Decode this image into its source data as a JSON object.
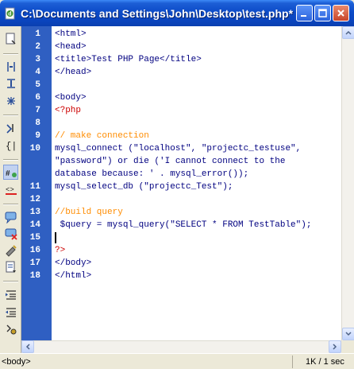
{
  "window": {
    "title": "C:\\Documents and Settings\\John\\Desktop\\test.php*",
    "app_icon": "dreamweaver-file-icon"
  },
  "toolbar": {
    "icons": [
      "document-icon",
      "expand-tag-icon",
      "collapse-selection-icon",
      "collapse-full-icon",
      "select-parent-tag-icon",
      "balance-braces-icon",
      "line-numbers-icon",
      "highlight-invalid-icon",
      "apply-comment-icon",
      "remove-comment-icon",
      "wrap-tag-icon",
      "recent-snippets-icon",
      "indent-icon",
      "outdent-icon",
      "format-source-icon"
    ]
  },
  "editor": {
    "lines": [
      {
        "n": "1",
        "text": "<html>",
        "kind": "tag"
      },
      {
        "n": "2",
        "text": "<head>",
        "kind": "tag"
      },
      {
        "n": "3",
        "text": "<title>Test PHP Page</title>",
        "kind": "tag"
      },
      {
        "n": "4",
        "text": "</head>",
        "kind": "tag"
      },
      {
        "n": "5",
        "text": "",
        "kind": "tag"
      },
      {
        "n": "6",
        "text": "<body>",
        "kind": "tag"
      },
      {
        "n": "7",
        "text": "<?php",
        "kind": "php"
      },
      {
        "n": "8",
        "text": "",
        "kind": "tag"
      },
      {
        "n": "9",
        "text": "// make connection",
        "kind": "comment"
      },
      {
        "n": "10",
        "text": "mysql_connect (\"localhost\", \"projectc_testuse\",",
        "kind": "code"
      },
      {
        "n": "",
        "text": "\"password\") or die ('I cannot connect to the",
        "kind": "code"
      },
      {
        "n": "",
        "text": "database because: ' . mysql_error());",
        "kind": "code"
      },
      {
        "n": "11",
        "text": "mysql_select_db (\"projectc_Test\");",
        "kind": "code"
      },
      {
        "n": "12",
        "text": "",
        "kind": "tag"
      },
      {
        "n": "13",
        "text": "//build query",
        "kind": "comment"
      },
      {
        "n": "14",
        "text": " $query = mysql_query(\"SELECT * FROM TestTable\");",
        "kind": "code"
      },
      {
        "n": "15",
        "text": "",
        "kind": "tag"
      },
      {
        "n": "16",
        "text": "?>",
        "kind": "php"
      },
      {
        "n": "17",
        "text": "</body>",
        "kind": "tag"
      },
      {
        "n": "18",
        "text": "</html>",
        "kind": "tag"
      }
    ]
  },
  "statusbar": {
    "tag_selector": "<body>",
    "size": "1K / 1 sec"
  }
}
